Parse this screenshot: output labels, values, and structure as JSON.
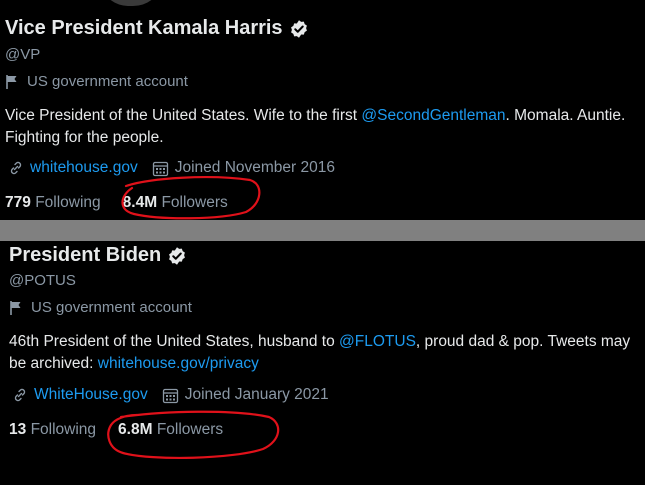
{
  "colors": {
    "background": "#000000",
    "text": "#e7e9ea",
    "secondary": "#8b98a5",
    "link": "#1d9bf0",
    "divider": "#808080",
    "annotation": "#e0111a"
  },
  "profiles": [
    {
      "name": "Vice President Kamala Harris",
      "handle": "@VP",
      "gov_label": "US government account",
      "bio": {
        "text_before": "Vice President of the United States. Wife to the first ",
        "mention": "@SecondGentleman",
        "text_after": ". Momala. Auntie. Fighting for the people."
      },
      "website": "whitehouse.gov",
      "joined": "Joined November 2016",
      "following_count": "779",
      "following_label": "Following",
      "followers_count": "8.4M",
      "followers_label": "Followers"
    },
    {
      "name": "President Biden",
      "handle": "@POTUS",
      "gov_label": "US government account",
      "bio": {
        "text_before": "46th President of the United States, husband to ",
        "mention": "@FLOTUS",
        "text_mid": ", proud dad & pop. Tweets may be archived: ",
        "link": "whitehouse.gov/privacy"
      },
      "website": "WhiteHouse.gov",
      "joined": "Joined January 2021",
      "following_count": "13",
      "following_label": "Following",
      "followers_count": "6.8M",
      "followers_label": "Followers"
    }
  ]
}
